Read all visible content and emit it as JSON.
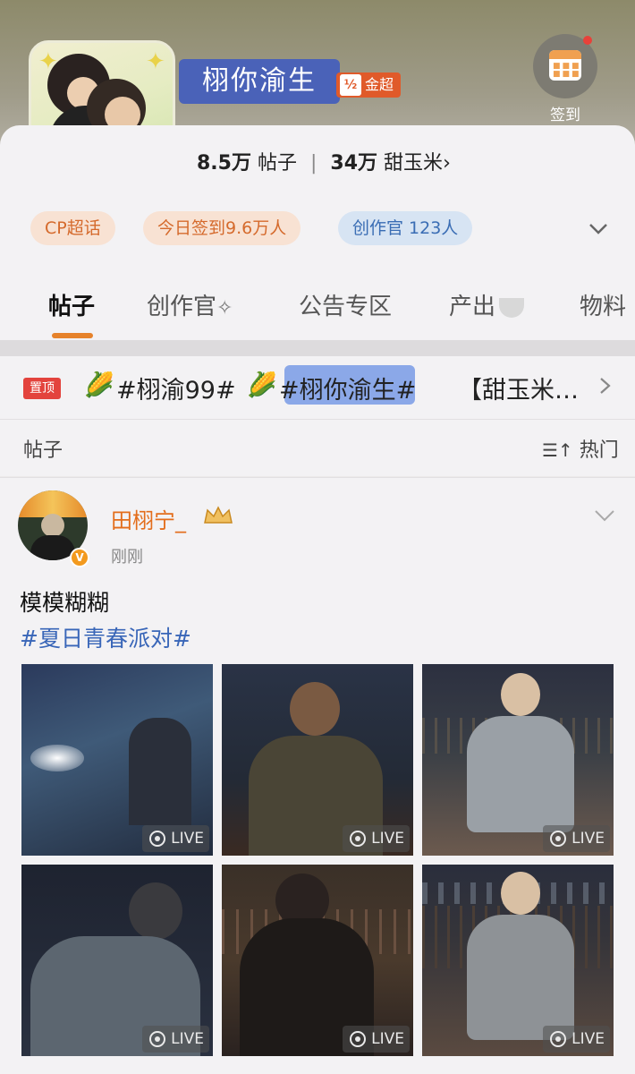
{
  "header": {
    "title": "栩你渝生",
    "badge_icon": "½",
    "badge_label": "金超",
    "checkin_label": "签到",
    "posts_count": "8.5万",
    "posts_label": "帖子",
    "fans_count": "34万",
    "fans_label": "甜玉米",
    "fans_arrow": "›"
  },
  "tags": {
    "cp": "CP超话",
    "today": "今日签到9.6万人",
    "creator": "创作官 123人"
  },
  "tabs": [
    {
      "label": "帖子"
    },
    {
      "label": "创作官"
    },
    {
      "label": "公告专区"
    },
    {
      "label": "产出"
    },
    {
      "label": "物料"
    }
  ],
  "pinned": {
    "badge": "置顶",
    "item1": "#栩渝99#",
    "item2": "#栩你渝生#",
    "item3": "【甜玉米…"
  },
  "section": {
    "label": "帖子",
    "sort_label": "热门"
  },
  "post": {
    "author": "田栩宁_",
    "time": "刚刚",
    "text": "模模糊糊",
    "hashtag": "#夏日青春派对#",
    "live_label": "LIVE"
  },
  "colors": {
    "accent_orange": "#e36d1b",
    "link_blue": "#3966b8",
    "pin_red": "#e3433d"
  }
}
